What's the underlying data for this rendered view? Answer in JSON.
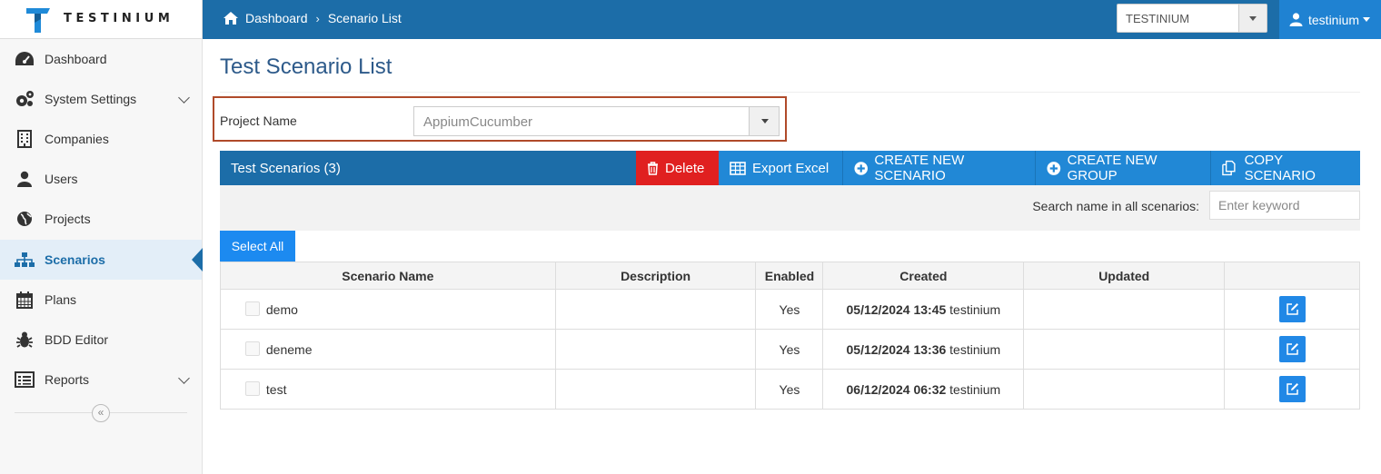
{
  "brand": {
    "name": "TESTINIUM"
  },
  "breadcrumb": {
    "home": "Dashboard",
    "current": "Scenario List"
  },
  "tenant_select": {
    "value": "TESTINIUM"
  },
  "user_menu": {
    "name": "testinium"
  },
  "sidebar": {
    "items": [
      {
        "label": "Dashboard",
        "icon": "dashboard-icon"
      },
      {
        "label": "System Settings",
        "icon": "gears-icon",
        "expandable": true
      },
      {
        "label": "Companies",
        "icon": "building-icon"
      },
      {
        "label": "Users",
        "icon": "user-icon"
      },
      {
        "label": "Projects",
        "icon": "globe-icon"
      },
      {
        "label": "Scenarios",
        "icon": "sitemap-icon",
        "active": true
      },
      {
        "label": "Plans",
        "icon": "calendar-icon"
      },
      {
        "label": "BDD Editor",
        "icon": "bug-icon"
      },
      {
        "label": "Reports",
        "icon": "list-icon",
        "expandable": true
      }
    ],
    "collapse_glyph": "«"
  },
  "page": {
    "title": "Test Scenario List"
  },
  "project": {
    "label": "Project Name",
    "value": "AppiumCucumber"
  },
  "panel": {
    "title": "Test Scenarios (3)",
    "buttons": {
      "delete": "Delete",
      "export": "Export Excel",
      "new_scenario": "CREATE NEW SCENARIO",
      "new_group": "CREATE NEW GROUP",
      "copy": "COPY SCENARIO"
    }
  },
  "search": {
    "label": "Search name in all scenarios:",
    "placeholder": "Enter keyword",
    "value": ""
  },
  "select_all": "Select All",
  "table": {
    "columns": [
      "Scenario Name",
      "Description",
      "Enabled",
      "Created",
      "Updated",
      ""
    ],
    "rows": [
      {
        "name": "demo",
        "description": "",
        "enabled": "Yes",
        "created_date": "05/12/2024 13:45",
        "created_by": "testinium",
        "updated": ""
      },
      {
        "name": "deneme",
        "description": "",
        "enabled": "Yes",
        "created_date": "05/12/2024 13:36",
        "created_by": "testinium",
        "updated": ""
      },
      {
        "name": "test",
        "description": "",
        "enabled": "Yes",
        "created_date": "06/12/2024 06:32",
        "created_by": "testinium",
        "updated": ""
      }
    ]
  },
  "colors": {
    "topbar": "#1c6da8",
    "accent": "#2188d6",
    "danger": "#e02020",
    "highlight_border": "#b04a2a"
  }
}
